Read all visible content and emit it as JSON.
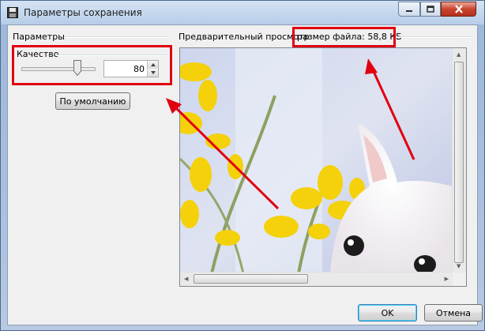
{
  "window": {
    "title": "Параметры сохранения"
  },
  "params": {
    "section_label": "Параметры",
    "quality_label": "Качество",
    "quality_value": "80",
    "quality_level": 0.8,
    "default_button": "По умолчанию"
  },
  "preview": {
    "label": "Предварительный просмотр",
    "file_size": "размер файла: 58,8 КБ"
  },
  "buttons": {
    "ok": "OK",
    "cancel": "Отмена"
  },
  "colors": {
    "highlight": "#e00010",
    "accent": "#3c7fb1"
  }
}
